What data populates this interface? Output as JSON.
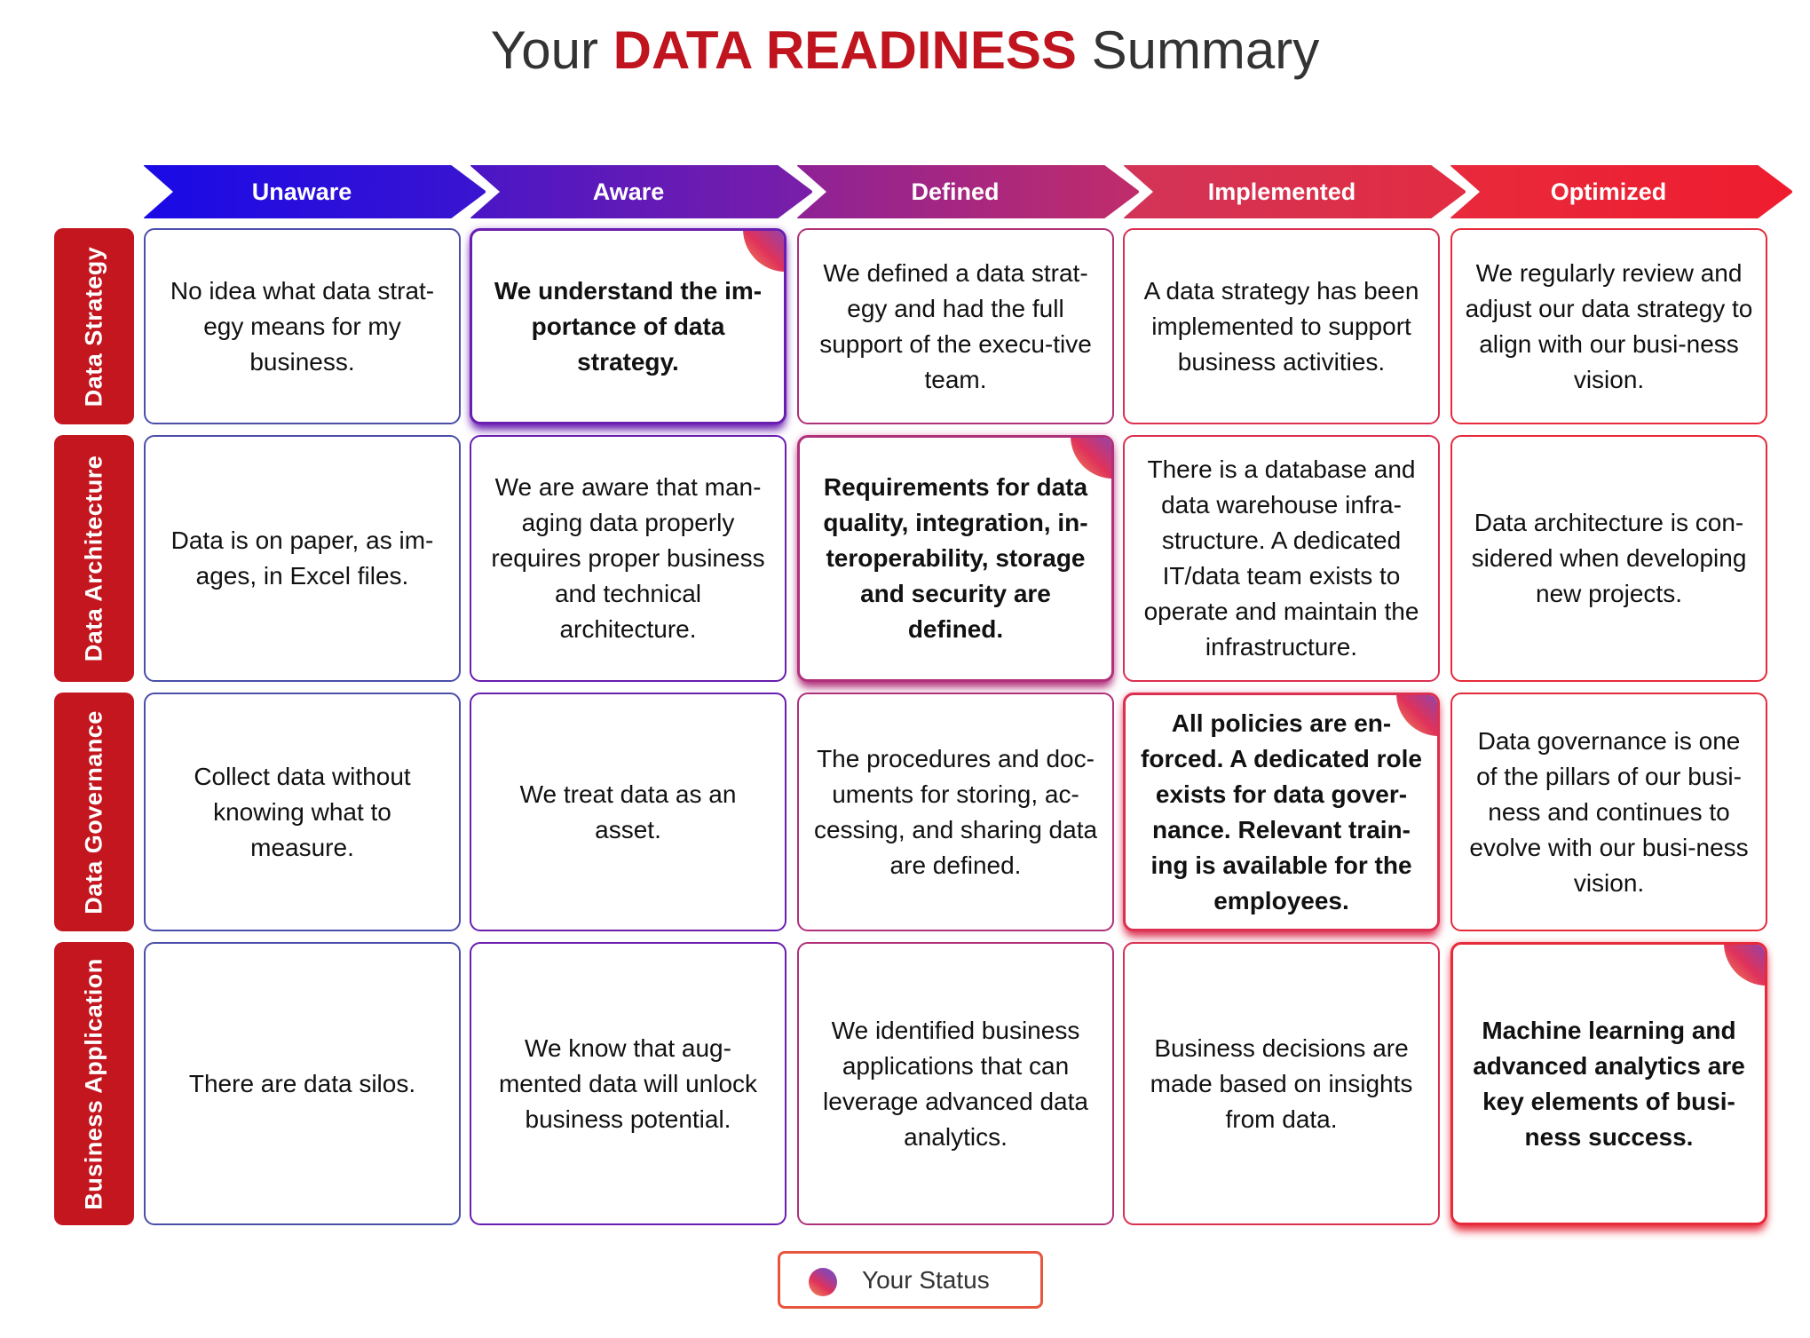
{
  "title": {
    "prefix": "Your",
    "highlight": "DATA READINESS",
    "suffix": "Summary"
  },
  "colors": {
    "title_accent": "#c0141f",
    "row_label_bg": "#c3161f",
    "legend_border": "#e8553f",
    "stage_gradient_start": "#1a0ae6",
    "stage_gradient_end": "#ee1c2e"
  },
  "stages": [
    {
      "label": "Unaware",
      "color": "#3a22c8"
    },
    {
      "label": "Aware",
      "color": "#6a1eb0"
    },
    {
      "label": "Defined",
      "color": "#b02a78"
    },
    {
      "label": "Implemented",
      "color": "#dc2f4e"
    },
    {
      "label": "Optimized",
      "color": "#ea2535"
    }
  ],
  "rows": [
    {
      "label": "Data Strategy",
      "active_stage": "Aware",
      "cells": [
        "No idea what data strat-egy means for my business.",
        "We understand the im-portance of data strategy.",
        "We defined a data strat-egy and had the full support of the execu-tive team.",
        "A data strategy has been implemented to support business activities.",
        "We regularly review and adjust our data strategy to align with our busi-ness vision."
      ]
    },
    {
      "label": "Data Architecture",
      "active_stage": "Defined",
      "cells": [
        "Data is on paper, as im-ages, in Excel files.",
        "We are aware that man-aging data properly requires proper business and technical architecture.",
        "Requirements for data quality, integration, in-teroperability, storage and security are defined.",
        "There is a database and data warehouse infra-structure. A dedicated IT/data team exists to operate and maintain the infrastructure.",
        "Data architecture is con-sidered when developing new projects."
      ]
    },
    {
      "label": "Data Governance",
      "active_stage": "Implemented",
      "cells": [
        "Collect data without knowing what to measure.",
        "We treat data as an asset.",
        "The procedures and doc-uments for storing, ac-cessing, and sharing data are defined.",
        "All policies are en-forced. A dedicated role exists for data gover-nance. Relevant train-ing is available for the employees.",
        "Data governance is one of the pillars of our busi-ness and continues to evolve with our busi-ness vision."
      ]
    },
    {
      "label": "Business Application",
      "active_stage": "Optimized",
      "cells": [
        "There are data silos.",
        "We know that aug-mented data will unlock business potential.",
        "We identified business applications that can leverage advanced data analytics.",
        "Business decisions are made based on insights from data.",
        "Machine learning and advanced analytics are key elements of busi-ness success."
      ]
    }
  ],
  "legend": {
    "icon": "status-dot-icon",
    "label": "Your Status"
  }
}
